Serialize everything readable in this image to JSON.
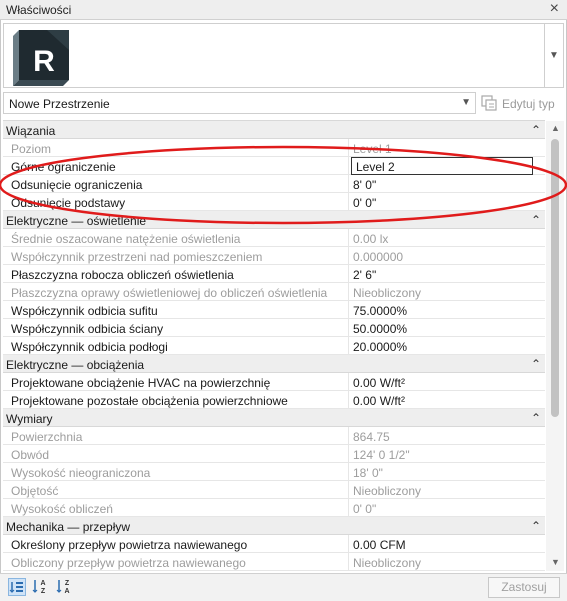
{
  "window": {
    "title": "Właściwości",
    "close_glyph": "×"
  },
  "preview": {
    "logo_letter": "R",
    "logo_icon": "revit-logo-icon",
    "dropdown_icon": "chevron-down-icon"
  },
  "type_selector": {
    "value": "Nowe Przestrzenie",
    "edit_type_label": "Edytuj typ"
  },
  "groups": [
    {
      "label": "Wiązania",
      "rows": [
        {
          "name": "Poziom",
          "value": "Level 1",
          "dim": true
        },
        {
          "name": "Górne ograniczenie",
          "value": "Level 2",
          "dim": false,
          "editing": true
        },
        {
          "name": "Odsunięcie ograniczenia",
          "value": "8'  0\"",
          "dim": false
        },
        {
          "name": "Odsunięcie podstawy",
          "value": "0'  0\"",
          "dim": false
        }
      ]
    },
    {
      "label": "Elektryczne — oświetlenie",
      "rows": [
        {
          "name": "Średnie oszacowane natężenie oświetlenia",
          "value": "0.00 lx",
          "dim": true
        },
        {
          "name": "Współczynnik przestrzeni nad pomieszczeniem",
          "value": "0.000000",
          "dim": true
        },
        {
          "name": "Płaszczyzna robocza obliczeń oświetlenia",
          "value": "2'  6\"",
          "dim": false
        },
        {
          "name": "Płaszczyzna oprawy oświetleniowej do obliczeń oświetlenia",
          "value": "Nieobliczony",
          "dim": true
        },
        {
          "name": "Współczynnik odbicia sufitu",
          "value": "75.0000%",
          "dim": false
        },
        {
          "name": "Współczynnik odbicia ściany",
          "value": "50.0000%",
          "dim": false
        },
        {
          "name": "Współczynnik odbicia podłogi",
          "value": "20.0000%",
          "dim": false
        }
      ]
    },
    {
      "label": "Elektryczne — obciążenia",
      "rows": [
        {
          "name": "Projektowane obciążenie HVAC na powierzchnię",
          "value": "0.00 W/ft²",
          "dim": false
        },
        {
          "name": "Projektowane pozostałe obciążenia powierzchniowe",
          "value": "0.00 W/ft²",
          "dim": false
        }
      ]
    },
    {
      "label": "Wymiary",
      "rows": [
        {
          "name": "Powierzchnia",
          "value": "864.75",
          "dim": true
        },
        {
          "name": "Obwód",
          "value": "124'  0 1/2\"",
          "dim": true
        },
        {
          "name": "Wysokość nieograniczona",
          "value": "18'  0\"",
          "dim": true
        },
        {
          "name": "Objętość",
          "value": "Nieobliczony",
          "dim": true
        },
        {
          "name": "Wysokość obliczeń",
          "value": "0'  0\"",
          "dim": true
        }
      ]
    },
    {
      "label": "Mechanika — przepływ",
      "rows": [
        {
          "name": "Określony przepływ powietrza nawiewanego",
          "value": "0.00 CFM",
          "dim": false
        },
        {
          "name": "Obliczony przepływ powietrza nawiewanego",
          "value": "Nieobliczony",
          "dim": true
        }
      ]
    }
  ],
  "footer": {
    "apply_label": "Zastosuj"
  },
  "colors": {
    "annotation_ellipse": "#e01b1b",
    "header_bg": "#eeeeee",
    "dim_text": "#9d9d9d"
  }
}
